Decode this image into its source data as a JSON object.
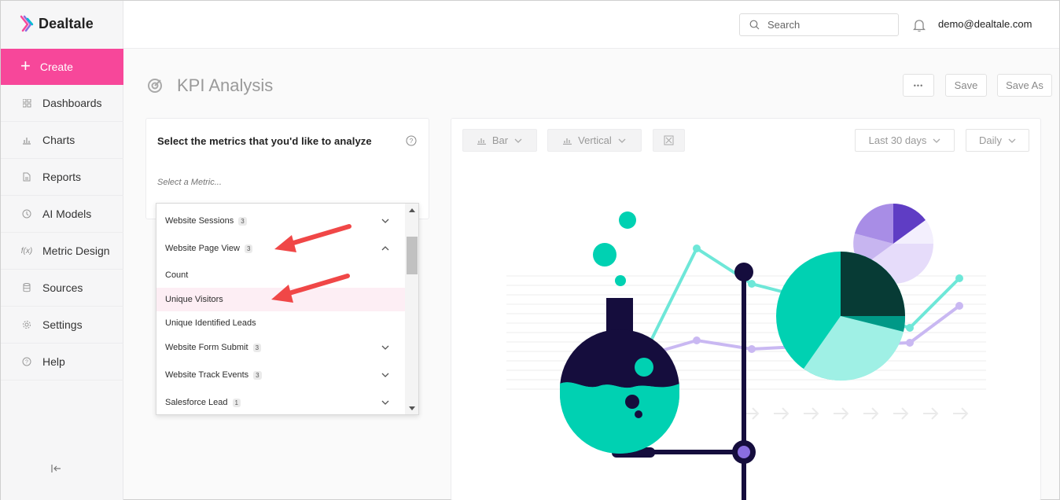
{
  "app": {
    "name": "Dealtale"
  },
  "sidebar": {
    "create_label": "Create",
    "items": [
      {
        "label": "Dashboards",
        "icon": "grid-icon"
      },
      {
        "label": "Charts",
        "icon": "bar-chart-icon"
      },
      {
        "label": "Reports",
        "icon": "document-icon"
      },
      {
        "label": "AI Models",
        "icon": "ai-icon"
      },
      {
        "label": "Metric Design",
        "icon": "function-icon"
      },
      {
        "label": "Sources",
        "icon": "database-icon"
      },
      {
        "label": "Settings",
        "icon": "gear-icon"
      },
      {
        "label": "Help",
        "icon": "help-icon"
      }
    ]
  },
  "header": {
    "search_placeholder": "Search",
    "user_email": "demo@dealtale.com"
  },
  "page": {
    "title": "KPI Analysis",
    "more_label": "•••",
    "save_label": "Save",
    "save_as_label": "Save As"
  },
  "metrics_panel": {
    "question": "Select the metrics that you'd like to analyze",
    "metric_placeholder": "Select a Metric...",
    "groups": [
      {
        "label": "Website Sessions",
        "count": "3",
        "expanded": false
      },
      {
        "label": "Website Page View",
        "count": "3",
        "expanded": true,
        "children": [
          "Count",
          "Unique Visitors",
          "Unique Identified Leads"
        ]
      },
      {
        "label": "Website Form Submit",
        "count": "3",
        "expanded": false
      },
      {
        "label": "Website Track Events",
        "count": "3",
        "expanded": false
      },
      {
        "label": "Salesforce Lead",
        "count": "1",
        "expanded": false
      }
    ],
    "highlighted_item": "Unique Visitors"
  },
  "chart_controls": {
    "chart_type": "Bar",
    "orientation": "Vertical",
    "date_range": "Last 30 days",
    "granularity": "Daily"
  },
  "colors": {
    "accent": "#f7479a",
    "teal": "#00d1b2",
    "navy": "#150d3d",
    "purple": "#8a6ee0",
    "annotation_arrow": "#f04747"
  }
}
